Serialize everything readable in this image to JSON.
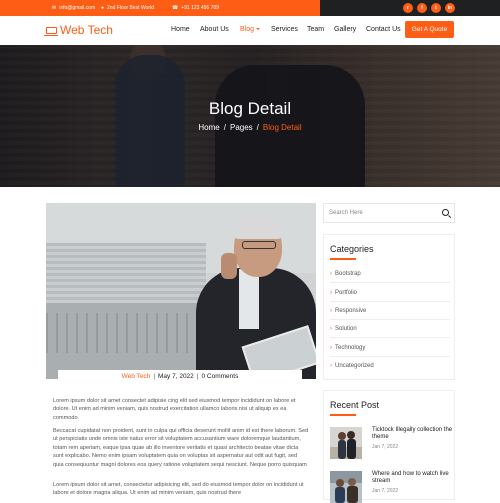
{
  "topbar": {
    "email": "info@gmail.com",
    "address": "2nd Floor Best World",
    "phone": "+91 123 456 789",
    "socials": [
      "rss-icon",
      "facebook-icon",
      "twitter-icon",
      "linkedin-icon"
    ],
    "social_glyphs": [
      "r",
      "f",
      "t",
      "in"
    ]
  },
  "brand": {
    "name": "Web Tech",
    "color": "#fd5d14"
  },
  "nav": {
    "items": [
      "Home",
      "About Us",
      "Blog",
      "Services",
      "Team",
      "Gallery",
      "Contact Us"
    ],
    "active": "Blog",
    "cta": "Get A Quote"
  },
  "hero": {
    "title": "Blog Detail",
    "breadcrumb": [
      "Home",
      "Pages",
      "Blog Detail"
    ],
    "separator": "/"
  },
  "article": {
    "category": "Web Tech",
    "date": "May 7, 2022",
    "comments": "0 Comments",
    "paragraphs": [
      "Lorem ipsum dolor sit amet consectet adipisie cing elit sed eiusmod tempor incididunt on labore et dolore. Ut enim ad minim veniam, quis nostrud exercitation ullamco laboris nisi ut aliquip ex ea commodo.",
      "Beccacat cupidatat non proident, sunt in culpa qui officia deserunt mollit anim id est there laborum. Sed ut perspiciatis unde omnis iste natus error sit voluptatem accusantium ware doloremque laudantium, totam rem aperiam, eaque ipsa quae ab illo inventore veritatis et quasi architecto beatae vitae dicta sunt explicabo. Nemo enim ipsam voluptatem quia on voluptas sit aspernatur aut odit aut fugit, sed quia consequuntur magni dolores eos query ratione voluptatem sequi nesciunt. Neque porro quisquam",
      "Lorem ipsum dolor sit amet, consectetur adipisicing elit, sed do eiusmod tempor dolor on incididunt ut labore et dolore magna aliqua. Ut enim ad minim veniam, quis nostrud there"
    ]
  },
  "sidebar": {
    "search_placeholder": "Search Here",
    "categories_title": "Categories",
    "categories": [
      "Bootstrap",
      "Portfolio",
      "Responsive",
      "Solution",
      "Technology",
      "Uncategorized"
    ],
    "recent_title": "Recent Post",
    "recent_posts": [
      {
        "title": "Ticktock Illegally collection the theme",
        "date": "Jan 7, 2022"
      },
      {
        "title": "Where and how to watch live stream",
        "date": "Jan 7, 2022"
      }
    ]
  }
}
